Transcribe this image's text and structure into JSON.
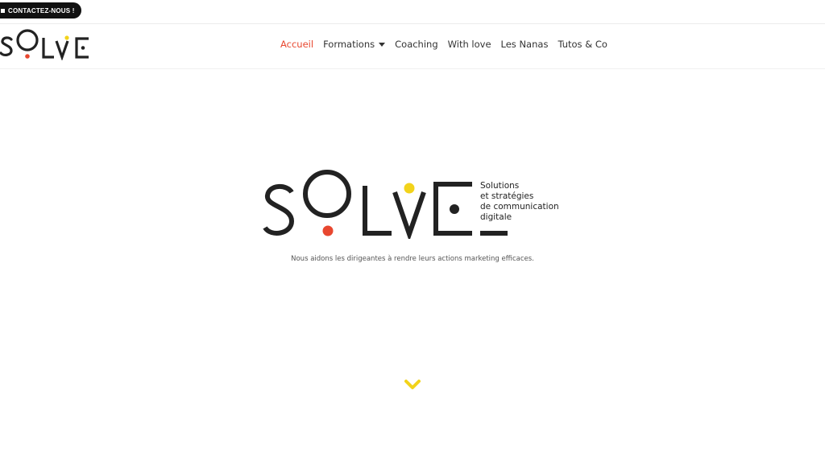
{
  "topbar": {
    "contact_label": "CONTACTEZ-NOUS !"
  },
  "brand": {
    "logo_text": "SOLVE",
    "tagline_lines": [
      "Solutions",
      "et stratégies",
      "de communication",
      "digitale"
    ],
    "colors": {
      "dark": "#222222",
      "red": "#e8472f",
      "yellow": "#f2d31b"
    }
  },
  "nav": {
    "items": [
      {
        "label": "Accueil",
        "active": true
      },
      {
        "label": "Formations",
        "dropdown": true
      },
      {
        "label": "Coaching"
      },
      {
        "label": "With love"
      },
      {
        "label": "Les Nanas"
      },
      {
        "label": "Tutos & Co"
      }
    ],
    "active_color": "#e8472f"
  },
  "hero": {
    "subtitle": "Nous aidons les dirigeantes à rendre leurs actions marketing efficaces.",
    "scroll_icon": "chevron-down-icon"
  }
}
